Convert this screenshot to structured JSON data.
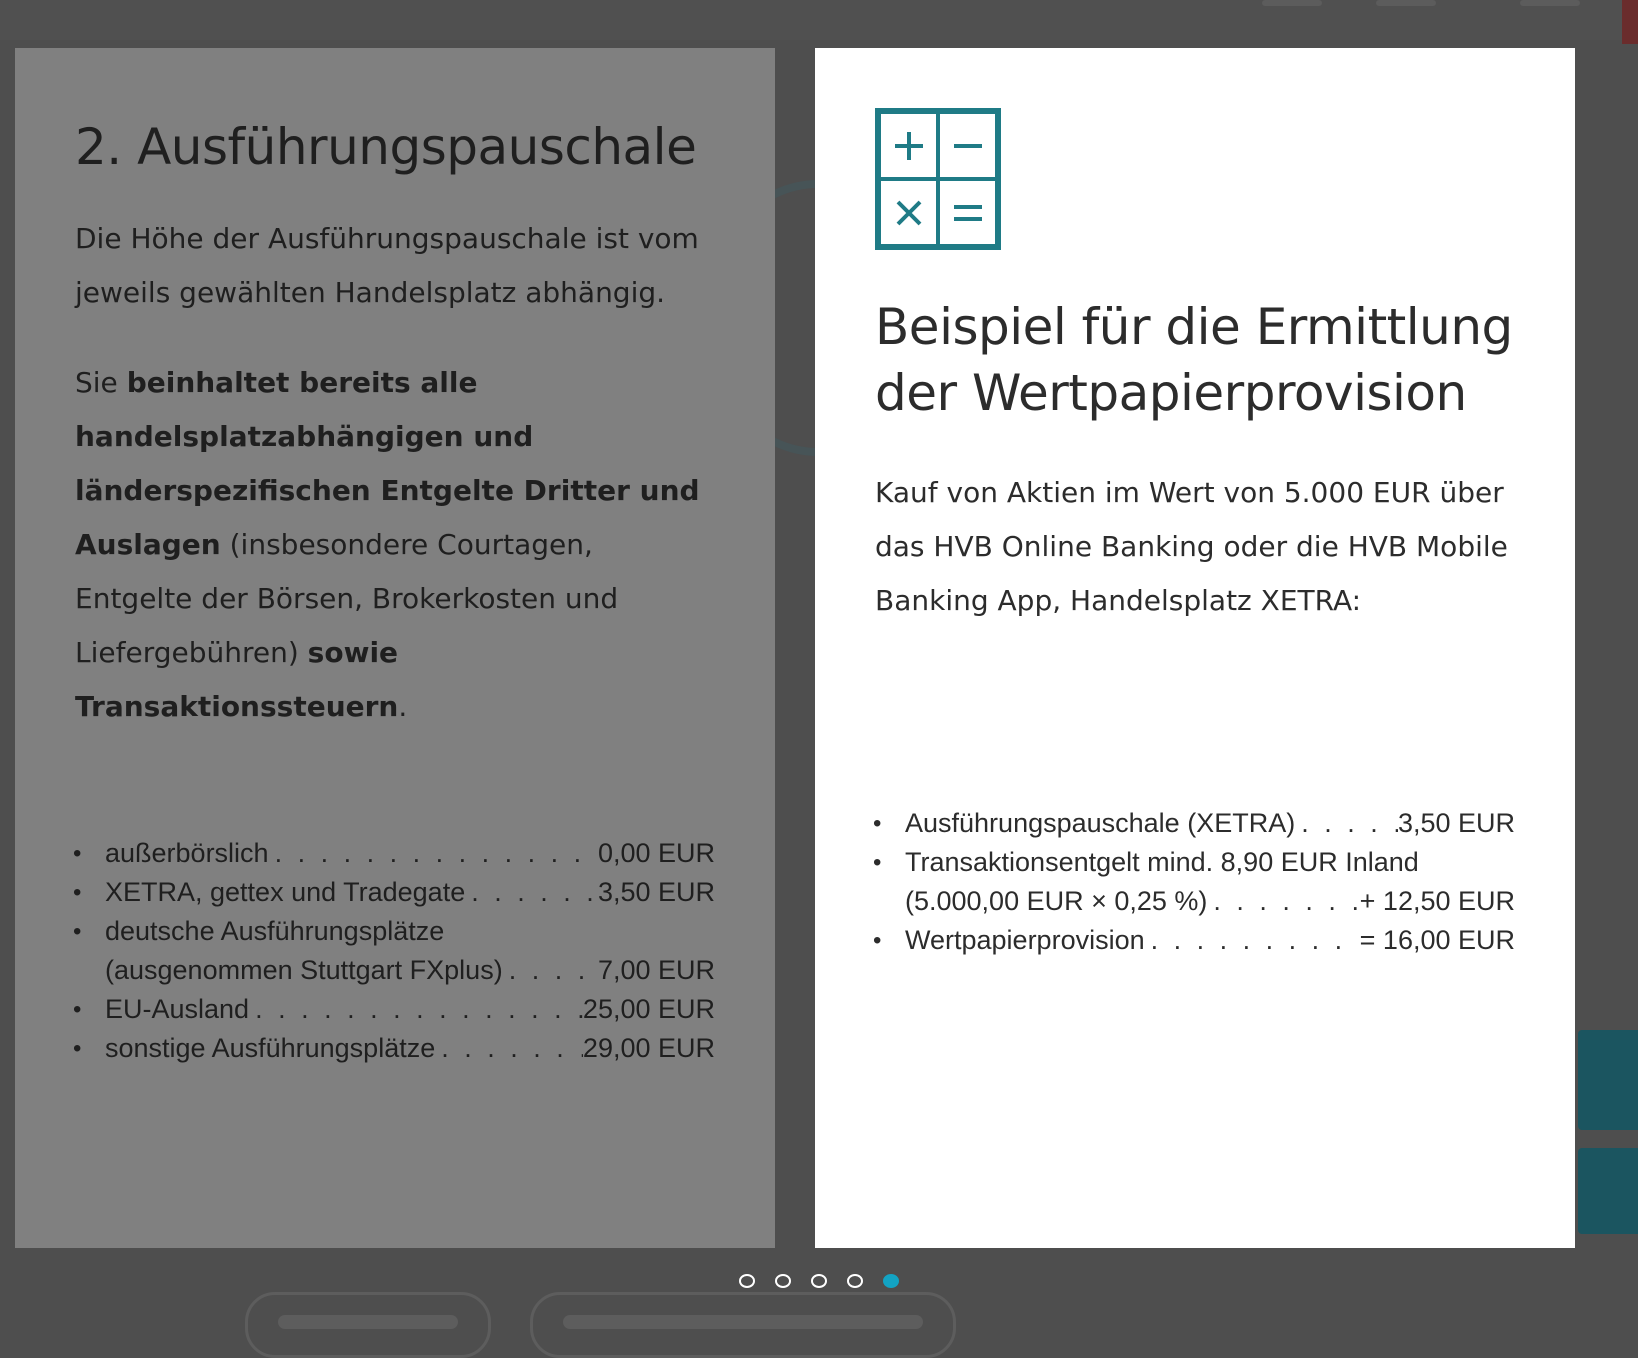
{
  "left_slide": {
    "title": "2. Ausführungspauschale",
    "intro": "Die Höhe der Ausführungspauschale ist vom jeweils gewählten Handelsplatz abhängig.",
    "desc_prefix": "Sie ",
    "desc_bold_1": "beinhaltet bereits alle handelsplatzabhängigen und länderspezifischen Entgelte Dritter und Auslagen",
    "desc_middle": " (insbesondere Courtagen, Entgelte der Börsen, Brokerkosten und Liefergebühren) ",
    "desc_bold_2": "sowie Transaktionssteuern",
    "desc_suffix": ".",
    "fees": [
      {
        "label": "außerbörslich",
        "value": "0,00 EUR"
      },
      {
        "label": "XETRA, gettex und Tradegate",
        "value": "3,50 EUR"
      },
      {
        "label": "deutsche Ausführungsplätze",
        "sublabel": "(ausgenommen Stuttgart FXplus)",
        "value": "7,00 EUR"
      },
      {
        "label": "EU-Ausland",
        "value": "25,00 EUR"
      },
      {
        "label": "sonstige Ausführungsplätze",
        "value": "29,00 EUR"
      }
    ]
  },
  "right_slide": {
    "icon": "calculator-icon",
    "title": "Beispiel für die Ermittlung der Wertpapierprovision",
    "intro": "Kauf von Aktien im Wert von 5.000 EUR über das HVB Online Banking oder die HVB Mobile Banking App, Handelsplatz XETRA:",
    "items": [
      {
        "label": "Ausführungspauschale (XETRA)",
        "value": "3,50 EUR"
      },
      {
        "label": "Transaktionsentgelt mind. 8,90 EUR Inland",
        "sublabel": "(5.000,00 EUR × 0,25 %)",
        "value": "+ 12,50 EUR"
      },
      {
        "label": "Wertpapierprovision",
        "value": "= 16,00 EUR"
      }
    ]
  },
  "pagination": {
    "count": 5,
    "active_index": 4
  },
  "colors": {
    "accent": "#1f7b86",
    "active_dot": "#13a3c3",
    "overlay": "#4e4e4e"
  }
}
